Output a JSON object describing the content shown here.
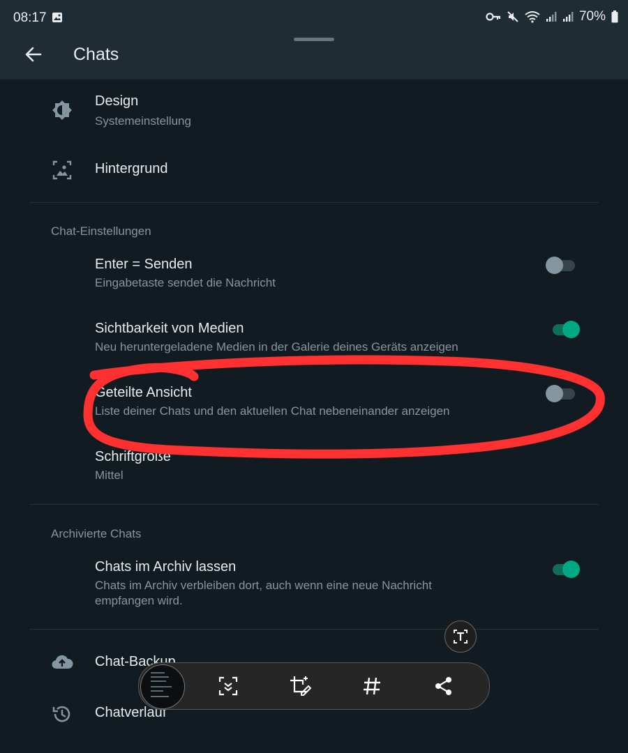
{
  "status_bar": {
    "time": "08:17",
    "battery": "70%"
  },
  "app_bar": {
    "title": "Chats"
  },
  "display": {
    "design": {
      "title": "Design",
      "subtitle": "Systemeinstellung"
    },
    "background": {
      "title": "Hintergrund"
    }
  },
  "chat_settings": {
    "header": "Chat-Einstellungen",
    "enter_send": {
      "title": "Enter = Senden",
      "subtitle": "Eingabetaste sendet die Nachricht",
      "enabled": false
    },
    "media_visibility": {
      "title": "Sichtbarkeit von Medien",
      "subtitle": "Neu heruntergeladene Medien in der Galerie deines Geräts anzeigen",
      "enabled": true
    },
    "split_view": {
      "title": "Geteilte Ansicht",
      "subtitle": "Liste deiner Chats und den aktuellen Chat nebeneinander anzeigen",
      "enabled": false
    },
    "font_size": {
      "title": "Schriftgröße",
      "subtitle": "Mittel"
    }
  },
  "archived": {
    "header": "Archivierte Chats",
    "keep_archived": {
      "title": "Chats im Archiv lassen",
      "subtitle": "Chats im Archiv verbleiben dort, auch wenn eine neue Nachricht empfangen wird.",
      "enabled": true
    }
  },
  "backup": {
    "title": "Chat-Backup"
  },
  "history": {
    "title": "Chatverlauf"
  },
  "colors": {
    "accent": "#00a884",
    "background": "#111b21",
    "annotation": "#ff3030"
  },
  "icons": [
    "back-arrow-icon",
    "brightness-icon",
    "wallpaper-icon",
    "cloud-upload-icon",
    "history-icon",
    "text-extract-icon",
    "scroll-capture-icon",
    "crop-edit-icon",
    "hashtag-icon",
    "share-icon"
  ]
}
